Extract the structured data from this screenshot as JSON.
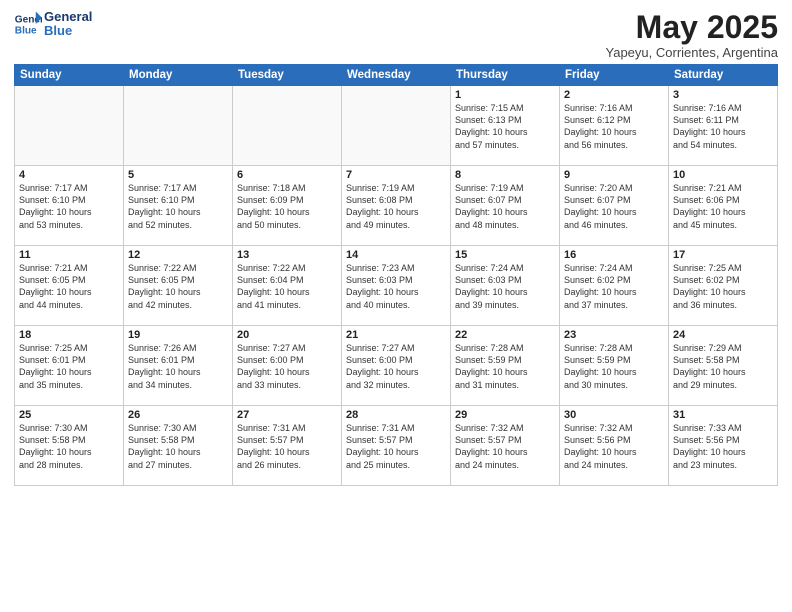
{
  "header": {
    "logo_line1": "General",
    "logo_line2": "Blue",
    "month_title": "May 2025",
    "subtitle": "Yapeyu, Corrientes, Argentina"
  },
  "days_of_week": [
    "Sunday",
    "Monday",
    "Tuesday",
    "Wednesday",
    "Thursday",
    "Friday",
    "Saturday"
  ],
  "weeks": [
    [
      {
        "day": "",
        "info": ""
      },
      {
        "day": "",
        "info": ""
      },
      {
        "day": "",
        "info": ""
      },
      {
        "day": "",
        "info": ""
      },
      {
        "day": "1",
        "info": "Sunrise: 7:15 AM\nSunset: 6:13 PM\nDaylight: 10 hours\nand 57 minutes."
      },
      {
        "day": "2",
        "info": "Sunrise: 7:16 AM\nSunset: 6:12 PM\nDaylight: 10 hours\nand 56 minutes."
      },
      {
        "day": "3",
        "info": "Sunrise: 7:16 AM\nSunset: 6:11 PM\nDaylight: 10 hours\nand 54 minutes."
      }
    ],
    [
      {
        "day": "4",
        "info": "Sunrise: 7:17 AM\nSunset: 6:10 PM\nDaylight: 10 hours\nand 53 minutes."
      },
      {
        "day": "5",
        "info": "Sunrise: 7:17 AM\nSunset: 6:10 PM\nDaylight: 10 hours\nand 52 minutes."
      },
      {
        "day": "6",
        "info": "Sunrise: 7:18 AM\nSunset: 6:09 PM\nDaylight: 10 hours\nand 50 minutes."
      },
      {
        "day": "7",
        "info": "Sunrise: 7:19 AM\nSunset: 6:08 PM\nDaylight: 10 hours\nand 49 minutes."
      },
      {
        "day": "8",
        "info": "Sunrise: 7:19 AM\nSunset: 6:07 PM\nDaylight: 10 hours\nand 48 minutes."
      },
      {
        "day": "9",
        "info": "Sunrise: 7:20 AM\nSunset: 6:07 PM\nDaylight: 10 hours\nand 46 minutes."
      },
      {
        "day": "10",
        "info": "Sunrise: 7:21 AM\nSunset: 6:06 PM\nDaylight: 10 hours\nand 45 minutes."
      }
    ],
    [
      {
        "day": "11",
        "info": "Sunrise: 7:21 AM\nSunset: 6:05 PM\nDaylight: 10 hours\nand 44 minutes."
      },
      {
        "day": "12",
        "info": "Sunrise: 7:22 AM\nSunset: 6:05 PM\nDaylight: 10 hours\nand 42 minutes."
      },
      {
        "day": "13",
        "info": "Sunrise: 7:22 AM\nSunset: 6:04 PM\nDaylight: 10 hours\nand 41 minutes."
      },
      {
        "day": "14",
        "info": "Sunrise: 7:23 AM\nSunset: 6:03 PM\nDaylight: 10 hours\nand 40 minutes."
      },
      {
        "day": "15",
        "info": "Sunrise: 7:24 AM\nSunset: 6:03 PM\nDaylight: 10 hours\nand 39 minutes."
      },
      {
        "day": "16",
        "info": "Sunrise: 7:24 AM\nSunset: 6:02 PM\nDaylight: 10 hours\nand 37 minutes."
      },
      {
        "day": "17",
        "info": "Sunrise: 7:25 AM\nSunset: 6:02 PM\nDaylight: 10 hours\nand 36 minutes."
      }
    ],
    [
      {
        "day": "18",
        "info": "Sunrise: 7:25 AM\nSunset: 6:01 PM\nDaylight: 10 hours\nand 35 minutes."
      },
      {
        "day": "19",
        "info": "Sunrise: 7:26 AM\nSunset: 6:01 PM\nDaylight: 10 hours\nand 34 minutes."
      },
      {
        "day": "20",
        "info": "Sunrise: 7:27 AM\nSunset: 6:00 PM\nDaylight: 10 hours\nand 33 minutes."
      },
      {
        "day": "21",
        "info": "Sunrise: 7:27 AM\nSunset: 6:00 PM\nDaylight: 10 hours\nand 32 minutes."
      },
      {
        "day": "22",
        "info": "Sunrise: 7:28 AM\nSunset: 5:59 PM\nDaylight: 10 hours\nand 31 minutes."
      },
      {
        "day": "23",
        "info": "Sunrise: 7:28 AM\nSunset: 5:59 PM\nDaylight: 10 hours\nand 30 minutes."
      },
      {
        "day": "24",
        "info": "Sunrise: 7:29 AM\nSunset: 5:58 PM\nDaylight: 10 hours\nand 29 minutes."
      }
    ],
    [
      {
        "day": "25",
        "info": "Sunrise: 7:30 AM\nSunset: 5:58 PM\nDaylight: 10 hours\nand 28 minutes."
      },
      {
        "day": "26",
        "info": "Sunrise: 7:30 AM\nSunset: 5:58 PM\nDaylight: 10 hours\nand 27 minutes."
      },
      {
        "day": "27",
        "info": "Sunrise: 7:31 AM\nSunset: 5:57 PM\nDaylight: 10 hours\nand 26 minutes."
      },
      {
        "day": "28",
        "info": "Sunrise: 7:31 AM\nSunset: 5:57 PM\nDaylight: 10 hours\nand 25 minutes."
      },
      {
        "day": "29",
        "info": "Sunrise: 7:32 AM\nSunset: 5:57 PM\nDaylight: 10 hours\nand 24 minutes."
      },
      {
        "day": "30",
        "info": "Sunrise: 7:32 AM\nSunset: 5:56 PM\nDaylight: 10 hours\nand 24 minutes."
      },
      {
        "day": "31",
        "info": "Sunrise: 7:33 AM\nSunset: 5:56 PM\nDaylight: 10 hours\nand 23 minutes."
      }
    ]
  ]
}
